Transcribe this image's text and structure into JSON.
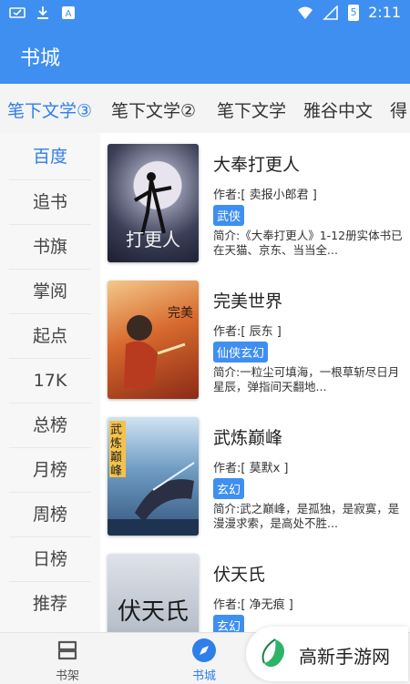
{
  "status_bar": {
    "time": "2:11",
    "battery": "5"
  },
  "app_bar": {
    "title": "书城"
  },
  "source_tabs": [
    "笔下文学③",
    "笔下文学②",
    "笔下文学",
    "雅谷中文",
    "得"
  ],
  "side_menu": [
    "百度",
    "追书",
    "书旗",
    "掌阅",
    "起点",
    "17K",
    "总榜",
    "月榜",
    "周榜",
    "日榜",
    "推荐"
  ],
  "books": [
    {
      "title": "大奉打更人",
      "author": "作者:[ 卖报小郎君 ]",
      "tag": "武侠",
      "desc": "简介:《大奉打更人》1-12册实体书已在天猫、京东、当当全..."
    },
    {
      "title": "完美世界",
      "author": "作者:[ 辰东 ]",
      "tag": "仙侠玄幻",
      "desc": "简介:一粒尘可填海，一根草斩尽日月星辰，弹指间天翻地..."
    },
    {
      "title": "武炼巅峰",
      "author": "作者:[ 莫默x ]",
      "tag": "玄幻",
      "desc": "简介:武之巅峰，是孤独，是寂寞，是漫漫求索，是高处不胜..."
    },
    {
      "title": "伏天氏",
      "author": "作者:[ 净无痕 ]",
      "tag": "玄幻",
      "desc": ""
    }
  ],
  "cover_texts": {
    "book1": "打更人",
    "book3": "武炼巅峰",
    "book4": "伏天氏"
  },
  "bottom_nav": {
    "shelf": "书架",
    "store": "书城"
  },
  "watermark": {
    "text": "高新手游网"
  },
  "colors": {
    "primary": "#3f8ff0",
    "active": "#2f7fe8"
  }
}
